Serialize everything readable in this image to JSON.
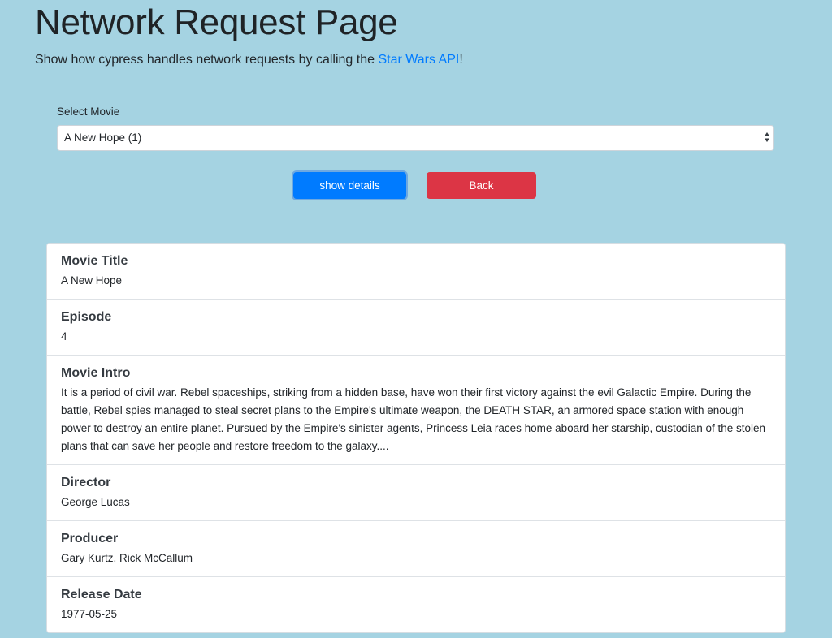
{
  "header": {
    "title": "Network Request Page",
    "subtitle_before": "Show how cypress handles network requests by calling the ",
    "subtitle_link": "Star Wars API",
    "subtitle_after": "!"
  },
  "form": {
    "select_label": "Select Movie",
    "selected_movie": "A New Hope (1)",
    "show_details_label": "show details",
    "back_label": "Back"
  },
  "details": [
    {
      "label": "Movie Title",
      "value": "A New Hope"
    },
    {
      "label": "Episode",
      "value": "4"
    },
    {
      "label": "Movie Intro",
      "value": "It is a period of civil war. Rebel spaceships, striking from a hidden base, have won their first victory against the evil Galactic Empire. During the battle, Rebel spies managed to steal secret plans to the Empire's ultimate weapon, the DEATH STAR, an armored space station with enough power to destroy an entire planet. Pursued by the Empire's sinister agents, Princess Leia races home aboard her starship, custodian of the stolen plans that can save her people and restore freedom to the galaxy...."
    },
    {
      "label": "Director",
      "value": "George Lucas"
    },
    {
      "label": "Producer",
      "value": "Gary Kurtz, Rick McCallum"
    },
    {
      "label": "Release Date",
      "value": "1977-05-25"
    }
  ],
  "colors": {
    "background": "#a5d3e2",
    "primary": "#007bff",
    "danger": "#dc3545",
    "link": "#007bff"
  }
}
